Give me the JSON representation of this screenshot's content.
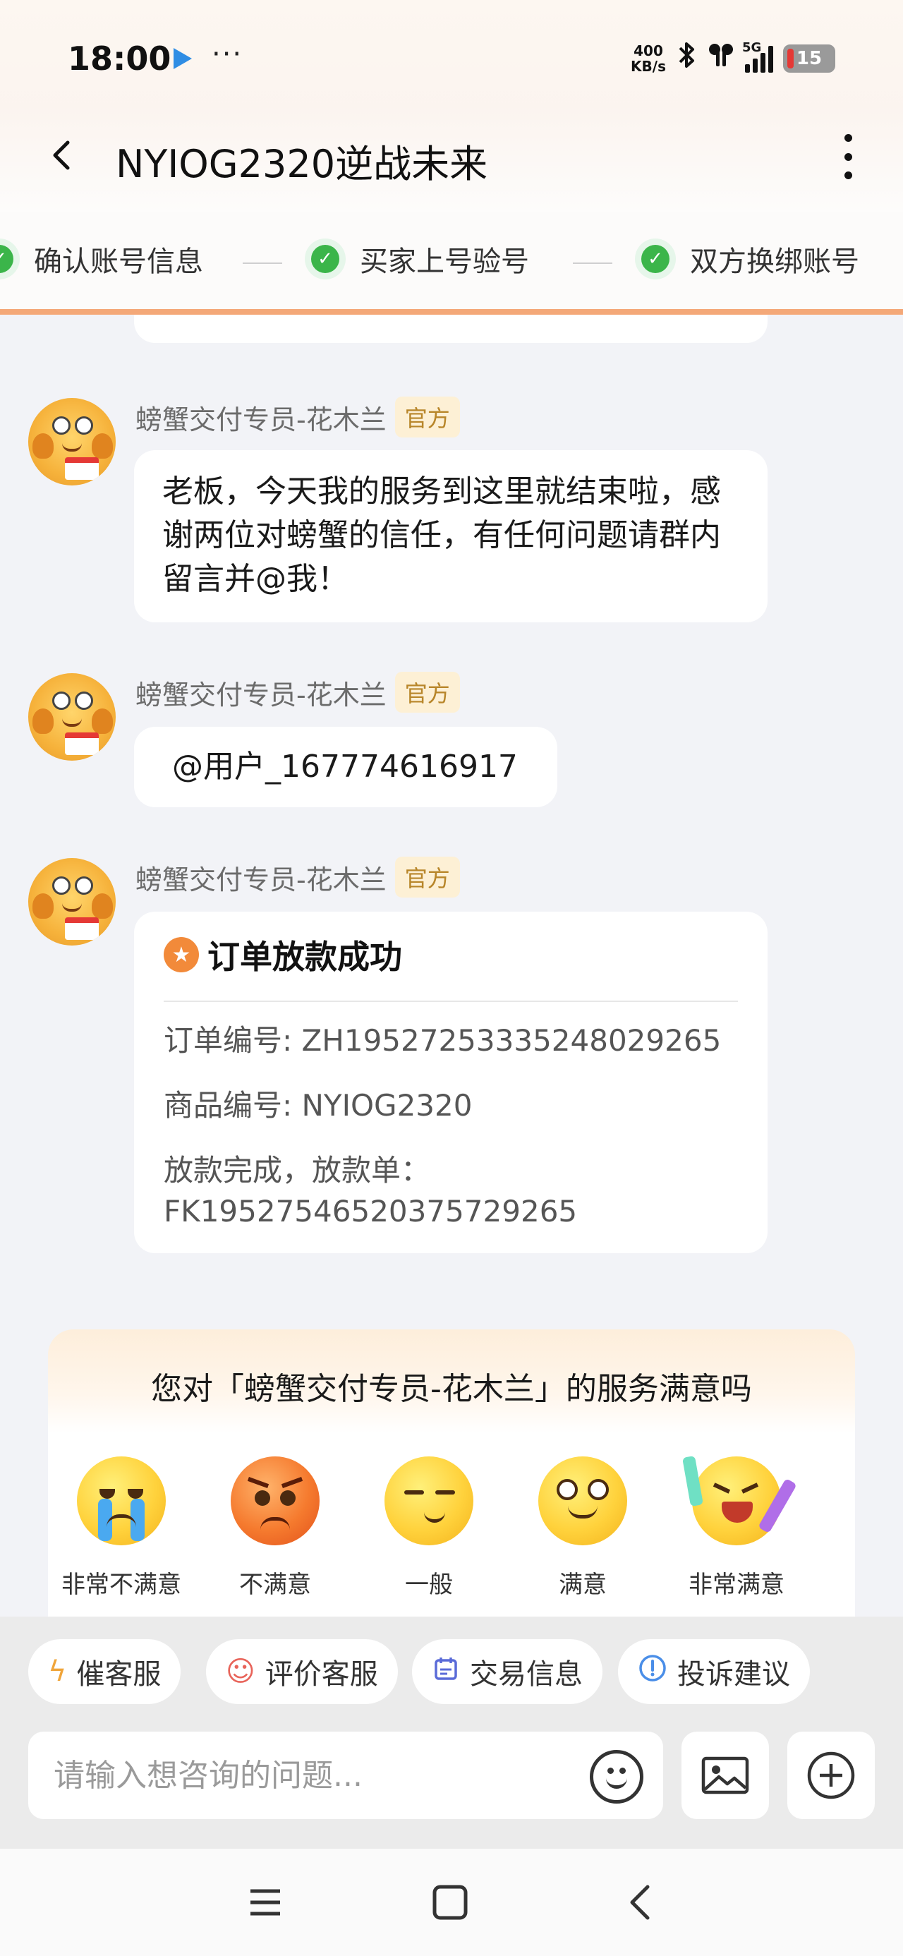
{
  "status_bar": {
    "time": "18:00",
    "more": "···",
    "net_speed_top": "400",
    "net_speed_bottom": "KB/s",
    "network": "5G",
    "battery": "15"
  },
  "header": {
    "title": "NYIOG2320逆战未来"
  },
  "steps": [
    {
      "label": "确认账号信息"
    },
    {
      "label": "买家上号验号"
    },
    {
      "label": "双方换绑账号"
    }
  ],
  "messages": [
    {
      "sender": "螃蟹交付专员-花木兰",
      "badge": "官方",
      "text": " 老板，今天我的服务到这里就结束啦，感谢两位对螃蟹的信任，有任何问题请群内留言并@我！"
    },
    {
      "sender": "螃蟹交付专员-花木兰",
      "badge": "官方",
      "text": "@用户_167774616917"
    },
    {
      "sender": "螃蟹交付专员-花木兰",
      "badge": "官方",
      "card": {
        "title": "订单放款成功",
        "order_no": "订单编号: ZH19527253335248029265",
        "product_no": "商品编号: NYIOG2320",
        "payout": "放款完成，放款单：FK19527546520375729265"
      }
    }
  ],
  "rating": {
    "question": "您对「螃蟹交付专员-花木兰」的服务满意吗",
    "options": [
      {
        "label": "非常不满意",
        "icon": "crying-face-icon"
      },
      {
        "label": "不满意",
        "icon": "angry-face-icon"
      },
      {
        "label": "一般",
        "icon": "neutral-face-icon"
      },
      {
        "label": "满意",
        "icon": "smiling-face-icon"
      },
      {
        "label": "非常满意",
        "icon": "cheering-face-icon"
      }
    ]
  },
  "quick_actions": [
    {
      "label": "催客服",
      "icon": "lightning-icon"
    },
    {
      "label": "评价客服",
      "icon": "smiley-icon"
    },
    {
      "label": "交易信息",
      "icon": "calendar-icon"
    },
    {
      "label": "投诉建议",
      "icon": "info-icon"
    }
  ],
  "input": {
    "placeholder": "请输入想咨询的问题..."
  },
  "colors": {
    "accent": "#f4a878",
    "check": "#3bb54a",
    "badge_bg": "#fdf0d5",
    "badge_text": "#b8862a"
  }
}
